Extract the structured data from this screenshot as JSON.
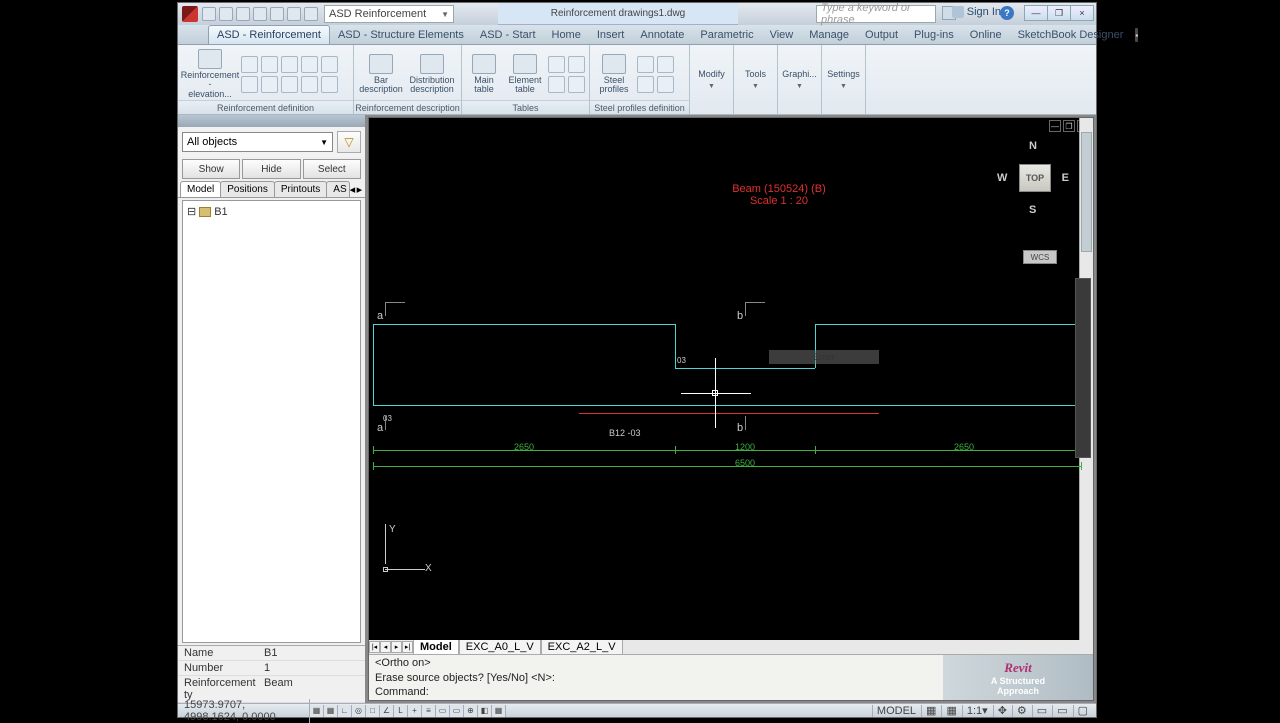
{
  "titlebar": {
    "document": "Reinforcement drawings1.dwg",
    "layer_combo": "ASD Reinforcement",
    "search_placeholder": "Type a keyword or phrase",
    "signin": "Sign In",
    "help": "?"
  },
  "win_controls": {
    "min": "—",
    "max": "❐",
    "close": "×"
  },
  "tabs": [
    {
      "label": "ASD - Reinforcement",
      "active": true
    },
    {
      "label": "ASD - Structure Elements"
    },
    {
      "label": "ASD - Start"
    },
    {
      "label": "Home"
    },
    {
      "label": "Insert"
    },
    {
      "label": "Annotate"
    },
    {
      "label": "Parametric"
    },
    {
      "label": "View"
    },
    {
      "label": "Manage"
    },
    {
      "label": "Output"
    },
    {
      "label": "Plug-ins"
    },
    {
      "label": "Online"
    },
    {
      "label": "SketchBook Designer"
    }
  ],
  "ribbon": {
    "reinf_elev": "Reinforcement -\nelevation...",
    "panel1": "Reinforcement definition",
    "bar_desc": "Bar\ndescription",
    "dist_desc": "Distribution\ndescription",
    "panel2": "Reinforcement description",
    "main_table": "Main\ntable",
    "elem_table": "Element\ntable",
    "panel3": "Tables",
    "steel_prof": "Steel\nprofiles",
    "panel4": "Steel profiles definition",
    "slim": [
      "Modify",
      "Tools",
      "Graphi...",
      "Settings"
    ]
  },
  "side": {
    "filter": "All objects",
    "buttons": [
      "Show",
      "Hide",
      "Select"
    ],
    "tabs": [
      "Model",
      "Positions",
      "Printouts",
      "AS"
    ],
    "tree_item": "B1",
    "props": [
      {
        "k": "Name",
        "v": "B1"
      },
      {
        "k": "Number",
        "v": "1"
      },
      {
        "k": "Reinforcement ty",
        "v": "Beam"
      }
    ]
  },
  "drawing": {
    "title1": "Beam (150524) (B)",
    "title2": "Scale 1 : 20",
    "marks": {
      "a": "a",
      "b": "b"
    },
    "ann03": "03",
    "rbar_label": "B12 -03",
    "dims": {
      "d1": "2650",
      "d2": "1200",
      "d3": "2650",
      "total": "6500"
    },
    "enter": "Enter",
    "viewcube": {
      "face": "TOP",
      "n": "N",
      "s": "S",
      "e": "E",
      "w": "W"
    },
    "wcs": "WCS",
    "ucs": {
      "x": "X",
      "y": "Y"
    }
  },
  "layout_tabs": [
    "Model",
    "EXC_A0_L_V",
    "EXC_A2_L_V"
  ],
  "cmd": {
    "line1": "<Ortho on>",
    "line2": "Erase source objects? [Yes/No] <N>:",
    "prompt": "Command:"
  },
  "revit": {
    "title": "Revit",
    "sub": "A Structured\nApproach"
  },
  "status": {
    "coords": "15973.9707, 4998.1624, 0.0000",
    "right": {
      "space": "MODEL",
      "scale": "1:1"
    }
  }
}
